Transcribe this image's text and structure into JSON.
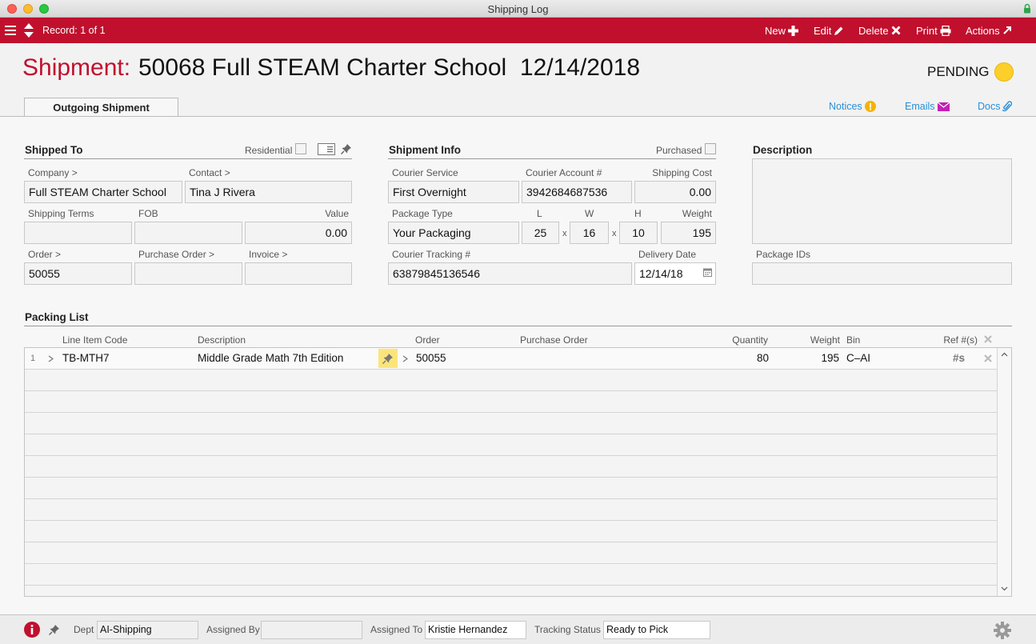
{
  "window": {
    "title": "Shipping Log"
  },
  "toolbar": {
    "record": "Record: 1 of 1",
    "new": "New",
    "edit": "Edit",
    "delete": "Delete",
    "print": "Print",
    "actions": "Actions"
  },
  "header": {
    "label": "Shipment:",
    "title": "50068 Full STEAM Charter School  12/14/2018",
    "status": "PENDING",
    "status_color": "#fccf2a",
    "tab": "Outgoing Shipment",
    "links": {
      "notices": "Notices",
      "emails": "Emails",
      "docs": "Docs"
    }
  },
  "shipped_to": {
    "title": "Shipped To",
    "residential_label": "Residential",
    "company_label": "Company >",
    "company": "Full STEAM Charter School",
    "contact_label": "Contact >",
    "contact": "Tina J Rivera",
    "shipping_terms_label": "Shipping Terms",
    "shipping_terms": "",
    "fob_label": "FOB",
    "fob": "",
    "value_label": "Value",
    "value": "0.00",
    "order_label": "Order >",
    "order": "50055",
    "purchase_order_label": "Purchase Order >",
    "purchase_order": "",
    "invoice_label": "Invoice >",
    "invoice": ""
  },
  "shipment_info": {
    "title": "Shipment Info",
    "purchased_label": "Purchased",
    "courier_service_label": "Courier Service",
    "courier_service": "First Overnight",
    "courier_account_label": "Courier Account #",
    "courier_account": "3942684687536",
    "shipping_cost_label": "Shipping Cost",
    "shipping_cost": "0.00",
    "package_type_label": "Package Type",
    "package_type": "Your Packaging",
    "l_label": "L",
    "l": "25",
    "w_label": "W",
    "w": "16",
    "h_label": "H",
    "h": "10",
    "x": "x",
    "weight_label": "Weight",
    "weight": "195",
    "tracking_label": "Courier Tracking #",
    "tracking": "63879845136546",
    "delivery_date_label": "Delivery Date",
    "delivery_date": "12/14/18"
  },
  "description": {
    "title": "Description",
    "text": "",
    "package_ids_label": "Package IDs",
    "package_ids": ""
  },
  "packing_list": {
    "title": "Packing List",
    "columns": {
      "line_item_code": "Line Item Code",
      "description": "Description",
      "order": "Order",
      "purchase_order": "Purchase Order",
      "quantity": "Quantity",
      "weight": "Weight",
      "bin": "Bin",
      "refs": "Ref #(s)"
    },
    "rows": [
      {
        "num": "1",
        "code": "TB-MTH7",
        "description": "Middle Grade Math 7th Edition",
        "order": "50055",
        "purchase_order": "",
        "quantity": "80",
        "weight": "195",
        "bin": "C–AI",
        "refs": "#s"
      }
    ]
  },
  "footer": {
    "dept_label": "Dept",
    "dept": "AI-Shipping",
    "assigned_by_label": "Assigned By",
    "assigned_by": "",
    "assigned_to_label": "Assigned To",
    "assigned_to": "Kristie Hernandez",
    "tracking_status_label": "Tracking Status",
    "tracking_status": "Ready to Pick"
  }
}
